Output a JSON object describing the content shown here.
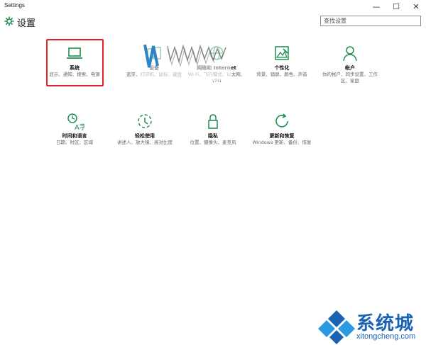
{
  "window": {
    "title": "Settings",
    "minimize_glyph": "—",
    "maximize_glyph": "☐",
    "close_glyph": "✕"
  },
  "header": {
    "title": "设置",
    "search_placeholder": "查找设置"
  },
  "colors": {
    "accent": "#1e8f4e",
    "selection": "#e3232b",
    "watermark": "#1a63b3"
  },
  "tiles": [
    {
      "title": "系统",
      "desc": "显示、通知、搜索、电源",
      "icon": "laptop-icon",
      "selected": true
    },
    {
      "title": "设备",
      "desc": "蓝牙、打印机、鼠标、键盘",
      "icon": "devices-icon"
    },
    {
      "title": "网络和 Internet",
      "desc": "Wi-Fi、飞行模式、以太网、VPN",
      "icon": "network-icon"
    },
    {
      "title": "个性化",
      "desc": "背景、锁屏、颜色、声音",
      "icon": "personalization-icon"
    },
    {
      "title": "帐户",
      "desc": "你的帐户、同步设置、工作区、家庭",
      "icon": "account-icon"
    },
    {
      "title": "时间和语言",
      "desc": "日期、时区、区域",
      "icon": "time-language-icon"
    },
    {
      "title": "轻松使用",
      "desc": "讲述人、放大镜、高对比度",
      "icon": "ease-of-access-icon"
    },
    {
      "title": "隐私",
      "desc": "位置、摄像头、麦克风",
      "icon": "lock-icon"
    },
    {
      "title": "更新和恢复",
      "desc": "Windows 更新、备份、恢复",
      "icon": "update-icon"
    }
  ],
  "watermark": {
    "brand_cn": "系统城",
    "brand_en": "xitongcheng.com"
  }
}
